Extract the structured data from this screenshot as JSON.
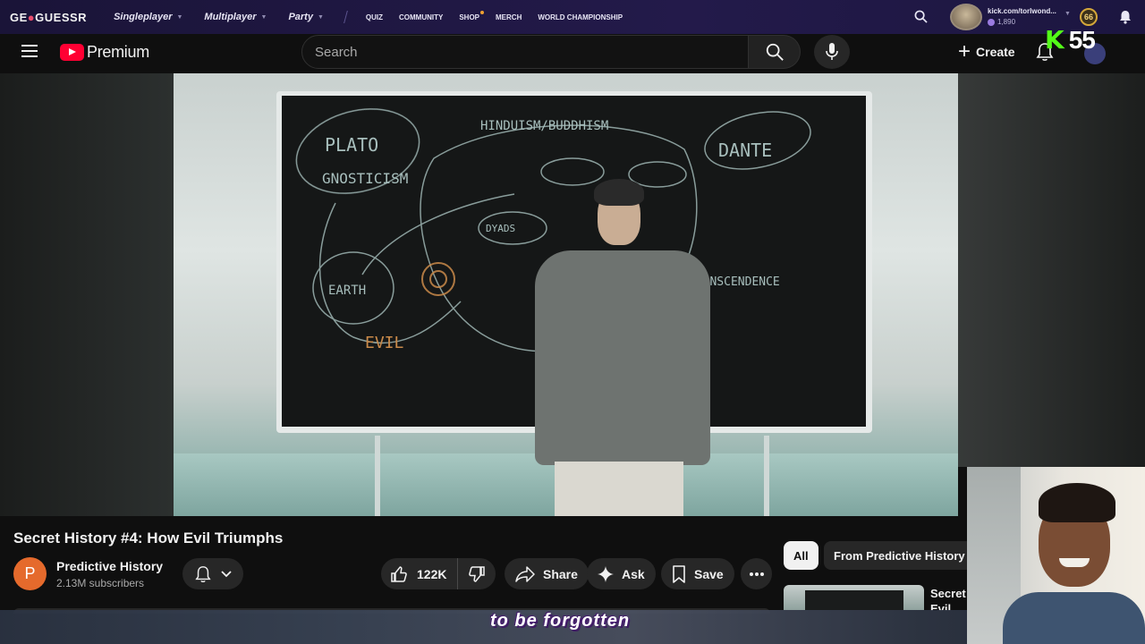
{
  "overlay_bar": {
    "logo_pre": "GE",
    "logo_pin": "●",
    "logo_post": "GUESSR",
    "nav_primary": [
      "Singleplayer",
      "Multiplayer",
      "Party"
    ],
    "nav_secondary": [
      "QUIZ",
      "COMMUNITY",
      "SHOP",
      "MERCH",
      "WORLD CHAMPIONSHIP"
    ],
    "user_url": "kick.com/torlwond...",
    "user_xp": "1,890",
    "level": "66"
  },
  "kick_badge": {
    "letter": "K",
    "count": "55"
  },
  "header": {
    "logo_text": "Premium",
    "search_placeholder": "Search",
    "create_label": "Create"
  },
  "video": {
    "title": "Secret History #4: How Evil Triumphs",
    "channel_initial": "P",
    "channel_name": "Predictive History",
    "subscribers": "2.13M subscribers",
    "likes": "122K",
    "share_label": "Share",
    "ask_label": "Ask",
    "save_label": "Save",
    "board_words": [
      "PLATO",
      "GNOSTICISM",
      "HINDUISM/BUDDHISM",
      "DANTE",
      "EARTH",
      "EVIL",
      "TRANSCENDENCE",
      "DYADS"
    ]
  },
  "sidebar": {
    "chips": [
      "All",
      "From Predictive History"
    ],
    "related_title": "Secret Evil"
  },
  "caption": "to be forgotten",
  "colors": {
    "accent_red": "#ff0033",
    "kick_green": "#53fc18",
    "geo_bg": "#231a4a"
  }
}
